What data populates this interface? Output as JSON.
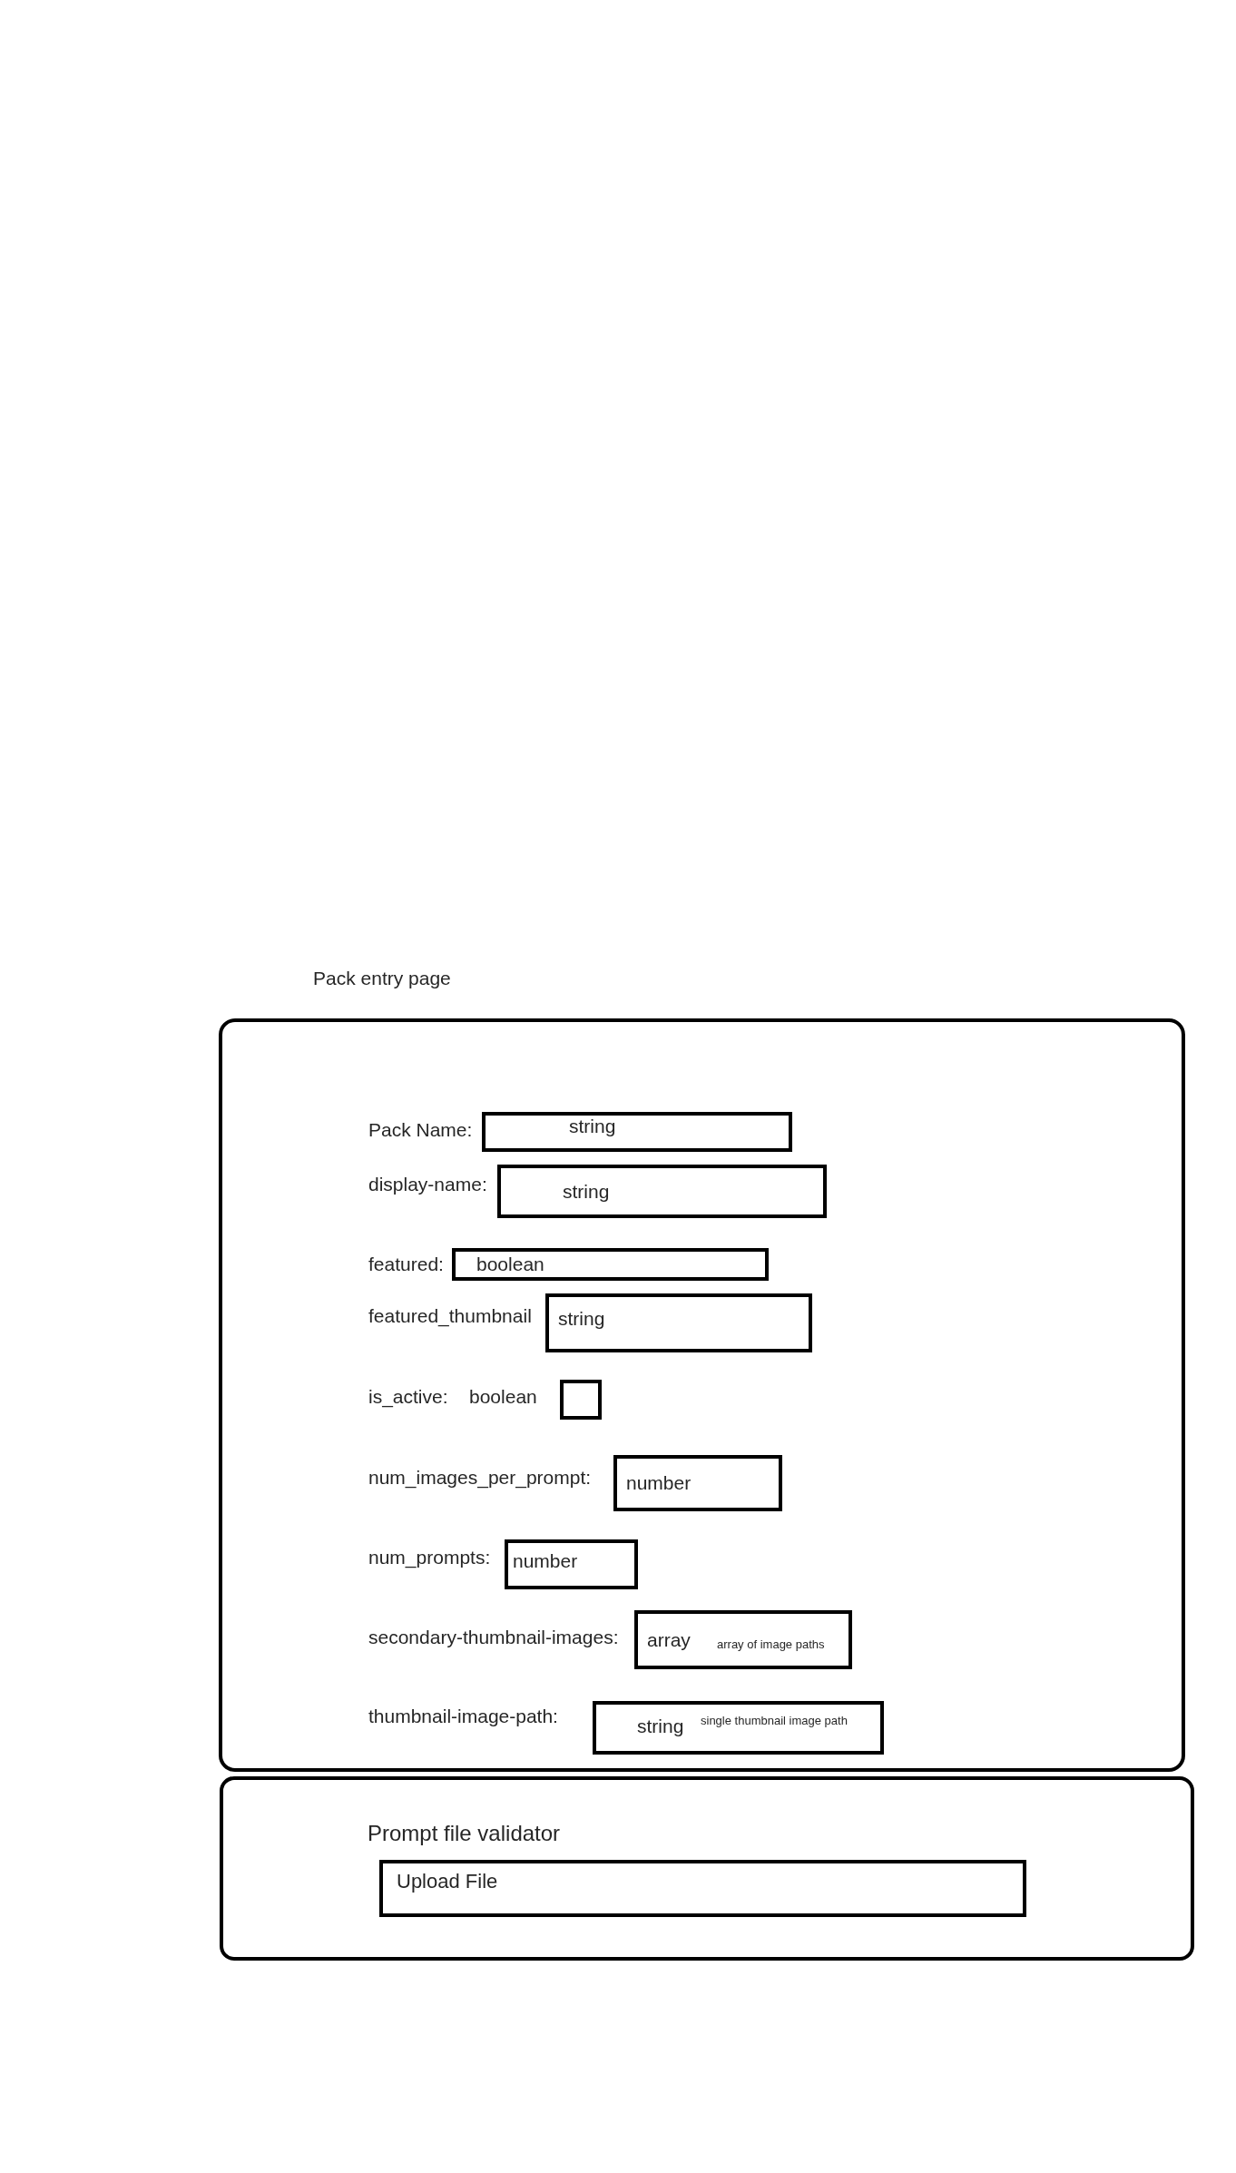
{
  "page_title": "Pack entry page",
  "pack_form": {
    "fields": [
      {
        "kind": "text",
        "label": "Pack Name:",
        "placeholder": "string"
      },
      {
        "kind": "text",
        "label": "display-name:",
        "placeholder": "string"
      },
      {
        "kind": "text",
        "label": "featured:",
        "placeholder": "boolean"
      },
      {
        "kind": "text",
        "label": "featured_thumbnail",
        "placeholder": "string"
      },
      {
        "kind": "checkbox",
        "label": "is_active:",
        "type_hint": "boolean",
        "checked": false
      },
      {
        "kind": "text",
        "label": "num_images_per_prompt:",
        "placeholder": "number"
      },
      {
        "kind": "text",
        "label": "num_prompts:",
        "placeholder": "number"
      },
      {
        "kind": "text",
        "label": "secondary-thumbnail-images:",
        "placeholder": "array",
        "note": "array of image paths"
      },
      {
        "kind": "text",
        "label": "thumbnail-image-path:",
        "placeholder": "string",
        "note": "single thumbnail image path"
      }
    ]
  },
  "prompt_validator": {
    "title": "Prompt file validator",
    "upload_button": "Upload File"
  }
}
